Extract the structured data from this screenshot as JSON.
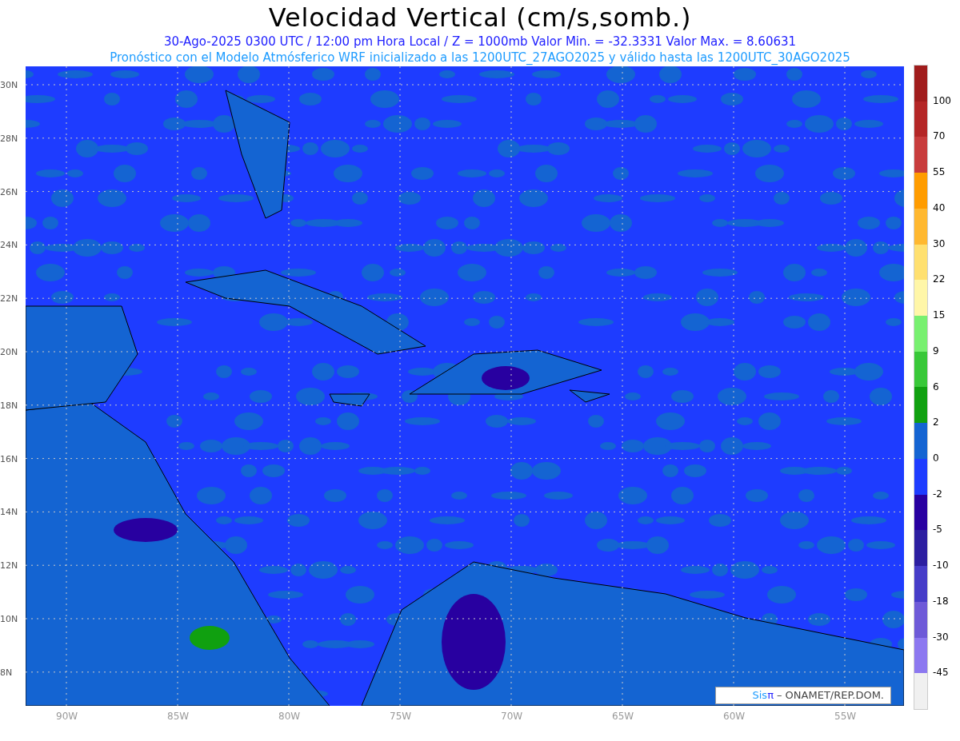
{
  "title": "Velocidad Vertical (cm/s,somb.)",
  "subtitle_lines": [
    "30-Ago-2025 0300 UTC / 12:00 pm Hora Local / Z = 1000mb  Valor Min. = -32.3331  Valor Max. = 8.60631",
    "Pronóstico con el Modelo Atmósferico WRF inicializado a las 1200UTC_27AGO2025 y válido hasta las  1200UTC_30AGO2025"
  ],
  "map": {
    "latitude_labels": [
      "30N",
      "28N",
      "26N",
      "24N",
      "22N",
      "20N",
      "18N",
      "16N",
      "14N",
      "12N",
      "10N",
      "8N"
    ],
    "longitude_labels": [
      "90W",
      "85W",
      "80W",
      "75W",
      "70W",
      "65W",
      "60W",
      "55W"
    ],
    "credit": {
      "logo_a": "Sis",
      "logo_b": "π",
      "text": "– ONAMET/REP.DOM."
    }
  },
  "colorbar": {
    "segments": [
      {
        "color": "#a01c1c"
      },
      {
        "color": "#b42626"
      },
      {
        "color": "#c83c3c"
      },
      {
        "color": "#ff9c00"
      },
      {
        "color": "#ffb830"
      },
      {
        "color": "#ffe070"
      },
      {
        "color": "#fff6a8"
      },
      {
        "color": "#78f070"
      },
      {
        "color": "#38c838"
      },
      {
        "color": "#10a010"
      },
      {
        "color": "#1464d2"
      },
      {
        "color": "#1e3cff"
      },
      {
        "color": "#2800a0"
      },
      {
        "color": "#2c1ea0"
      },
      {
        "color": "#463cc8"
      },
      {
        "color": "#6e5ad8"
      },
      {
        "color": "#8c78f0"
      },
      {
        "color": "#f0f0f0"
      }
    ],
    "labels": [
      "100",
      "70",
      "55",
      "40",
      "30",
      "22",
      "15",
      "9",
      "6",
      "2",
      "0",
      "-2",
      "-5",
      "-10",
      "-18",
      "-30",
      "-45"
    ]
  }
}
